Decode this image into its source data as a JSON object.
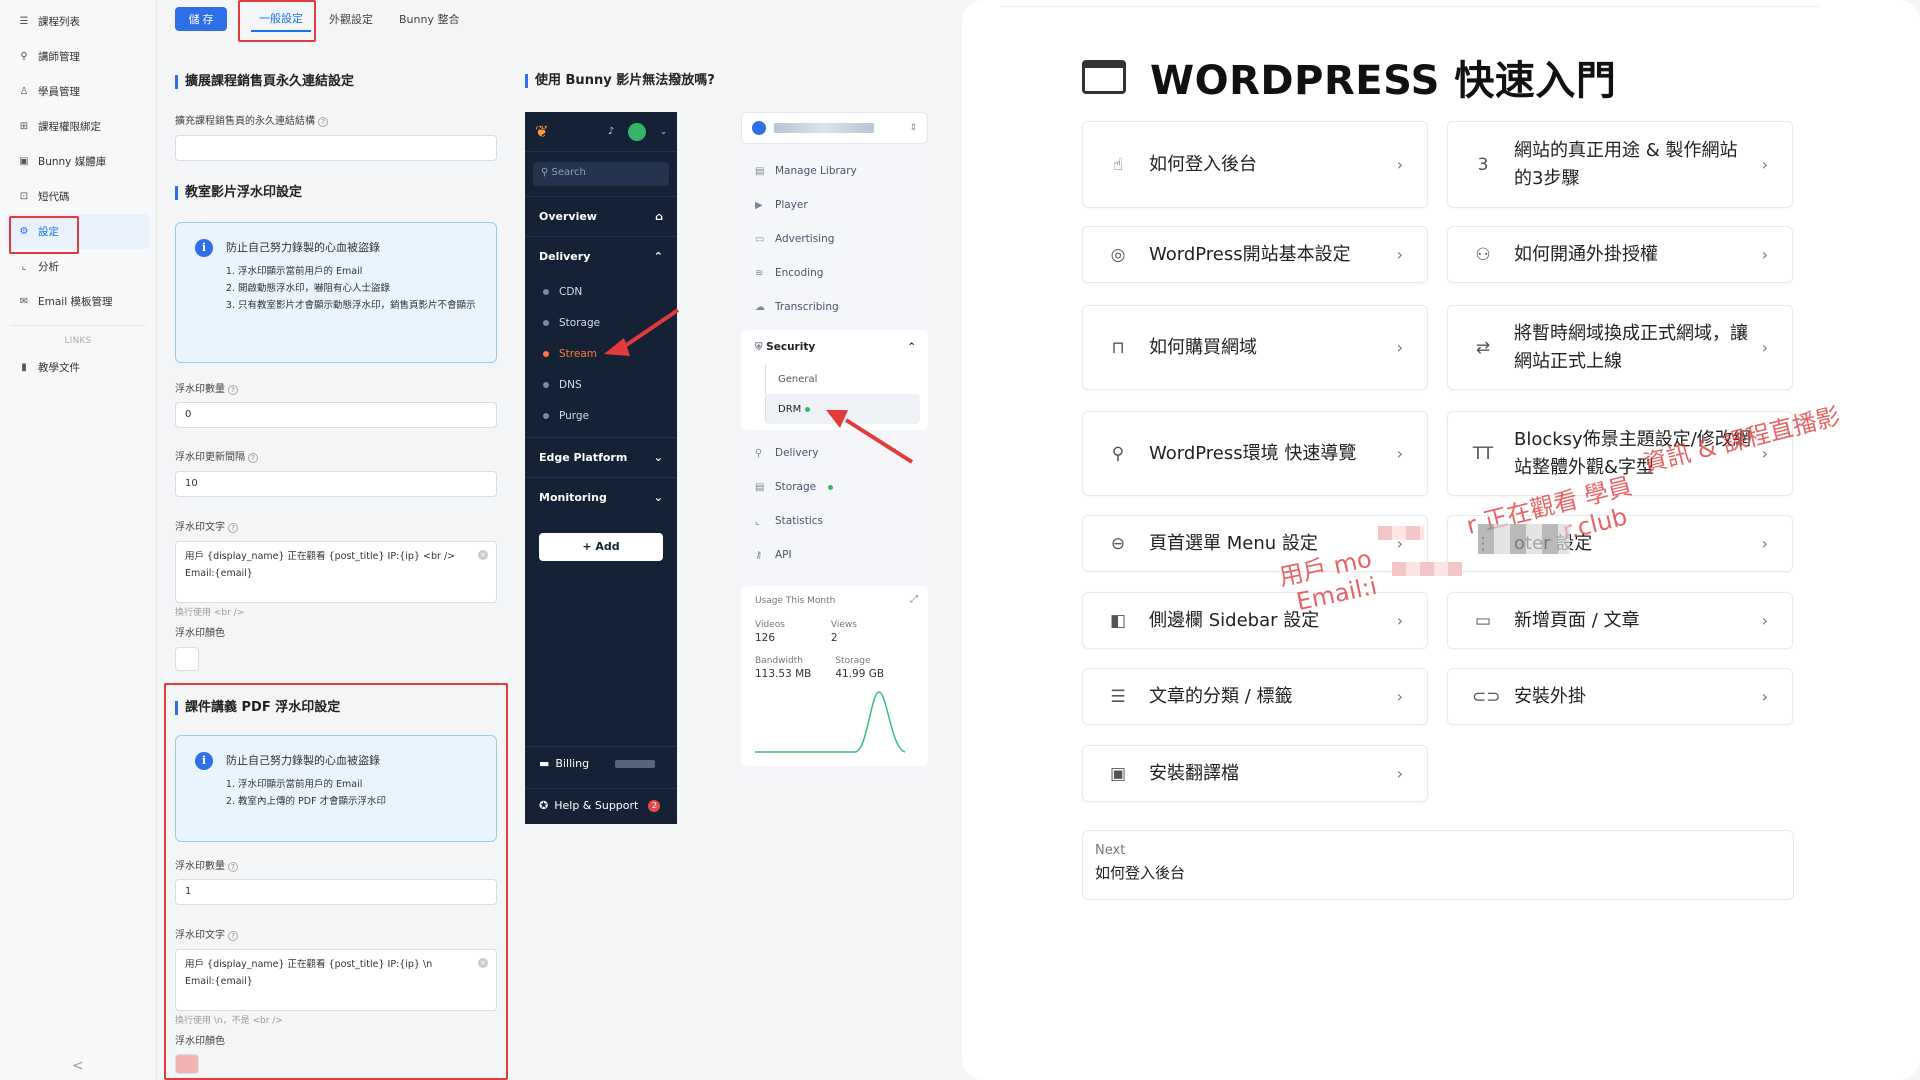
{
  "sidebar": {
    "items": [
      {
        "label": "課程列表",
        "icon": "list-icon"
      },
      {
        "label": "講師管理",
        "icon": "user-icon"
      },
      {
        "label": "學員管理",
        "icon": "students-icon"
      },
      {
        "label": "課程權限綁定",
        "icon": "grid-icon"
      },
      {
        "label": "Bunny 媒體庫",
        "icon": "media-icon"
      },
      {
        "label": "短代碼",
        "icon": "code-icon"
      },
      {
        "label": "設定",
        "icon": "gear-icon"
      },
      {
        "label": "分析",
        "icon": "chart-icon"
      },
      {
        "label": "Email 模板管理",
        "icon": "mail-icon"
      }
    ],
    "links_label": "LINKS",
    "doc_label": "教學文件",
    "collapse": "<"
  },
  "settings": {
    "save_label": "儲 存",
    "tabs": [
      "一般設定",
      "外觀設定",
      "Bunny 整合"
    ],
    "section1_title": "擴展課程銷售頁永久連結設定",
    "permalink_label": "擴充課程銷售頁的永久連結結構",
    "permalink_value": "",
    "section2_title": "教室影片浮水印設定",
    "info1": {
      "title": "防止自己努力錄製的心血被盜錄",
      "items": [
        "浮水印顯示當前用戶的 Email",
        "開啟動態浮水印，嚇阻有心人士盜錄",
        "只有教室影片才會顯示動態浮水印，銷售頁影片不會顯示"
      ]
    },
    "wm_count_label": "浮水印數量",
    "wm_count_value": "0",
    "wm_interval_label": "浮水印更新間隔",
    "wm_interval_value": "10",
    "wm_text_label": "浮水印文字",
    "wm_text_line1": "用戶 {display_name} 正在觀看 {post_title} IP:{ip} <br />",
    "wm_text_line2": "Email:{email}",
    "wm_text_hint": "換行使用 <br />",
    "wm_color_label": "浮水印顏色",
    "section3_title": "課件講義 PDF 浮水印設定",
    "info2": {
      "title": "防止自己努力錄製的心血被盜錄",
      "items": [
        "浮水印顯示當前用戶的 Email",
        "教室內上傳的 PDF 才會顯示浮水印"
      ]
    },
    "pdf_count_label": "浮水印數量",
    "pdf_count_value": "1",
    "pdf_text_label": "浮水印文字",
    "pdf_text_line1": "用戶 {display_name} 正在觀看 {post_title} IP:{ip} \\n",
    "pdf_text_line2": "Email:{email}",
    "pdf_text_hint": "換行使用 \\n，不是 <br />",
    "pdf_color_label": "浮水印顏色",
    "pdf_color": "#f3b3b3"
  },
  "bunny": {
    "title": "使用 Bunny 影片無法撥放嗎?",
    "search": "Search",
    "overview": "Overview",
    "delivery": "Delivery",
    "delivery_items": [
      "CDN",
      "Storage",
      "Stream",
      "DNS",
      "Purge"
    ],
    "edge": "Edge Platform",
    "monitoring": "Monitoring",
    "add": "+ Add",
    "billing": "Billing",
    "help": "Help & Support",
    "help_badge": "2",
    "library_items": [
      "Manage Library",
      "Player",
      "Advertising",
      "Encoding",
      "Transcribing"
    ],
    "security": "Security",
    "security_items": [
      "General",
      "DRM"
    ],
    "lower_items": [
      "Delivery",
      "Storage",
      "Statistics",
      "API"
    ],
    "usage": {
      "title": "Usage This Month",
      "videos_label": "Videos",
      "videos": "126",
      "views_label": "Views",
      "views": "2",
      "bandwidth_label": "Bandwidth",
      "bandwidth": "113.53 MB",
      "storage_label": "Storage",
      "storage": "41.99 GB"
    }
  },
  "wp": {
    "title": "WORDPRESS 快速入門",
    "cards_left": [
      {
        "label": "如何登入後台",
        "icon": "hand-icon"
      },
      {
        "label": "WordPress開站基本設定",
        "icon": "compass-icon"
      },
      {
        "label": "如何購買網域",
        "icon": "lock-icon"
      },
      {
        "label": "WordPress環境 快速導覽",
        "icon": "pin-icon"
      },
      {
        "label": "頁首選單 Menu 設定",
        "icon": "menu-circle-icon"
      },
      {
        "label": "側邊欄 Sidebar 設定",
        "icon": "sidebar-icon"
      },
      {
        "label": "文章的分類 / 標籤",
        "icon": "lines-icon"
      },
      {
        "label": "安裝翻譯檔",
        "icon": "translate-icon"
      }
    ],
    "cards_right": [
      {
        "label": "網站的真正用途 & 製作網站的3步驟",
        "icon": "number-3-icon"
      },
      {
        "label": "如何開通外掛授權",
        "icon": "user-add-icon"
      },
      {
        "label": "將暫時網域換成正式網域，讓網站正式上線",
        "icon": "swap-icon"
      },
      {
        "label": "Blocksy佈景主題設定/修改網站整體外觀&字型",
        "icon": "text-size-icon"
      },
      {
        "label": "oter 設定",
        "icon": "footer-icon"
      },
      {
        "label": "新增頁面 / 文章",
        "icon": "page-icon"
      },
      {
        "label": "安裝外掛",
        "icon": "plugin-icon"
      }
    ],
    "next_label": "Next",
    "next_value": "如何登入後台",
    "watermark1": "用戶 mo",
    "watermark2": "Email:i",
    "watermark3": "r 正在觀看 學員",
    "watermark4": "r.club",
    "watermark5": "資訊 & 課程直播影"
  }
}
